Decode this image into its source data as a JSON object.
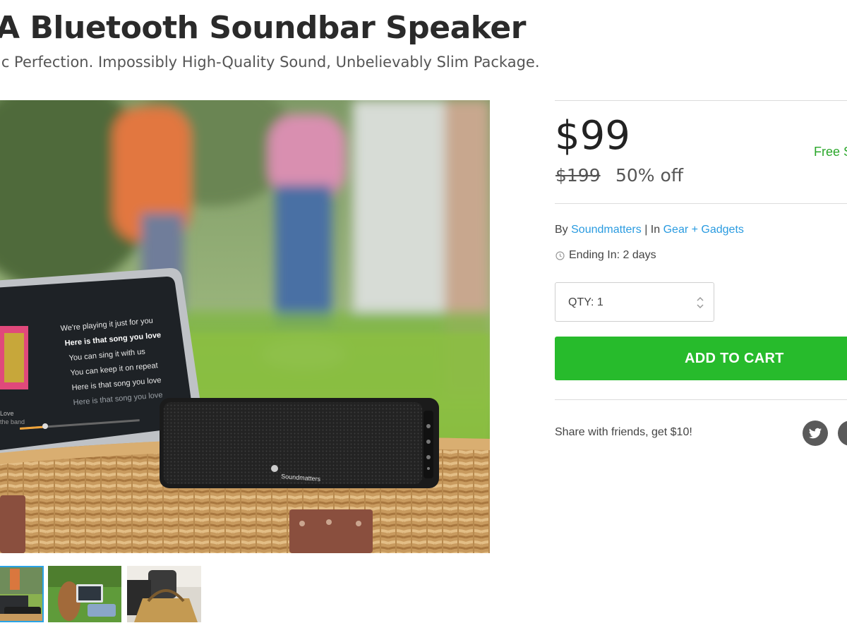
{
  "product": {
    "title": "A Bluetooth Soundbar Speaker",
    "subtitle": "ic Perfection. Impossibly High-Quality Sound, Unbelievably Slim Package."
  },
  "gallery": {
    "hero_lyrics": [
      "We're playing it just for you",
      "Here is that song you love",
      "You can sing it with us",
      "You can keep it on repeat",
      "Here is that song you love",
      "Here is that song you love"
    ],
    "hero_small_left": [
      "Love",
      "the band"
    ],
    "speaker_brand": "Soundmatters",
    "thumbnails": [
      {
        "name": "thumbnail-1",
        "active": true
      },
      {
        "name": "thumbnail-2",
        "active": false
      },
      {
        "name": "thumbnail-3",
        "active": false
      }
    ]
  },
  "pricing": {
    "price": "$99",
    "original_price": "$199",
    "discount": "50% off",
    "shipping": "Free S"
  },
  "meta": {
    "by_label": "By",
    "seller": "Soundmatters",
    "separator": "|",
    "in_label": "In",
    "category": "Gear + Gadgets",
    "ending_label": "Ending In: 2 days"
  },
  "purchase": {
    "qty_label": "QTY: 1",
    "add_to_cart": "ADD TO CART"
  },
  "share": {
    "text": "Share with friends, get $10!",
    "icons": [
      "twitter-icon",
      "facebook-icon"
    ]
  },
  "colors": {
    "accent_green": "#27bb2c",
    "link_blue": "#2a9be0",
    "free_shipping_green": "#2aa72a",
    "thumb_active_border": "#29a3e6"
  }
}
